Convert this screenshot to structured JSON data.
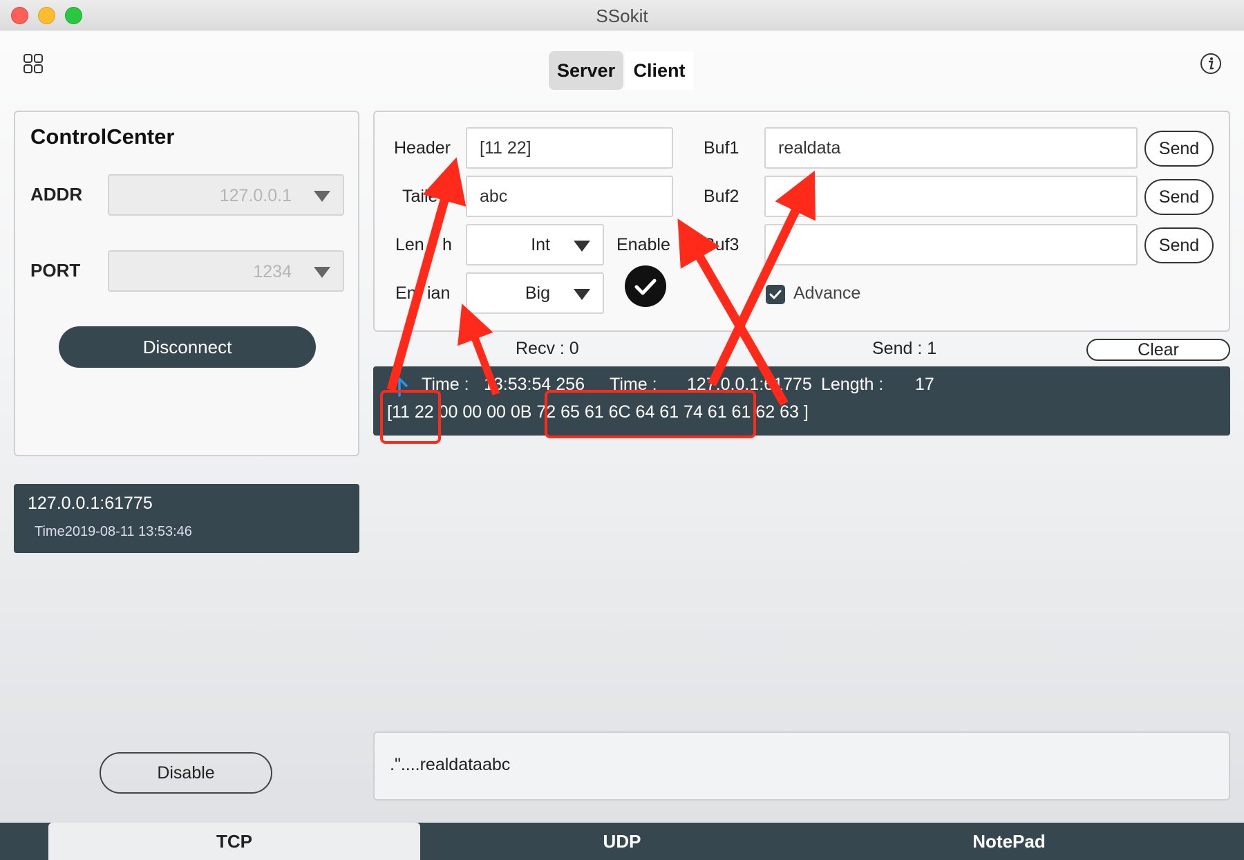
{
  "window": {
    "title": "SSokit"
  },
  "header": {
    "apps_icon": "apps-grid-icon",
    "info_icon": "info-icon",
    "mode_tabs": [
      {
        "label": "Server",
        "selected": true
      },
      {
        "label": "Client",
        "selected": false
      }
    ]
  },
  "control_center": {
    "title": "ControlCenter",
    "addr_label": "ADDR",
    "addr_value": "127.0.0.1",
    "port_label": "PORT",
    "port_value": "1234",
    "disconnect_label": "Disconnect"
  },
  "clients": [
    {
      "address": "127.0.0.1:61775",
      "time": "Time2019-08-11 13:53:46"
    }
  ],
  "disable_label": "Disable",
  "config": {
    "header_label": "Header",
    "header_value": "[11 22]",
    "tailer_label": "Taile",
    "tailer_value": "abc",
    "length_label_a": "Len",
    "length_label_b": "h",
    "length_value": "Int",
    "endian_label_a": "En",
    "endian_label_b": "ian",
    "endian_value": "Big",
    "enable_label": "Enable",
    "enable_checked": true,
    "buf1_label": "Buf1",
    "buf1_value": "realdata",
    "buf2_label": "Buf2",
    "buf2_value": "",
    "buf3_label": "Buf3",
    "buf3_value": "",
    "send_label": "Send",
    "advance_label": "Advance",
    "advance_checked": true
  },
  "stats": {
    "recv": "Recv : 0",
    "send": "Send : 1",
    "clear_label": "Clear"
  },
  "log": {
    "direction_icon": "arrow-up-icon",
    "time_label": "Time :",
    "time_value": "13:53:54 256",
    "time_label_2": "Time :",
    "address": "127.0.0.1:61775",
    "length_label": "Length :",
    "length_value": "17",
    "hex": "[11 22 00 00 00 0B 72 65 61 6C 64 61 74 61 61 62 63 ]"
  },
  "decoded_text": ".\"....realdataabc",
  "bottom_tabs": [
    {
      "label": "TCP",
      "selected": true
    },
    {
      "label": "UDP",
      "selected": false
    },
    {
      "label": "NotePad",
      "selected": false
    }
  ],
  "colors": {
    "accent_dark": "#37474f",
    "annotation_red": "#ff2a1a",
    "arrow_blue": "#2196f3"
  }
}
